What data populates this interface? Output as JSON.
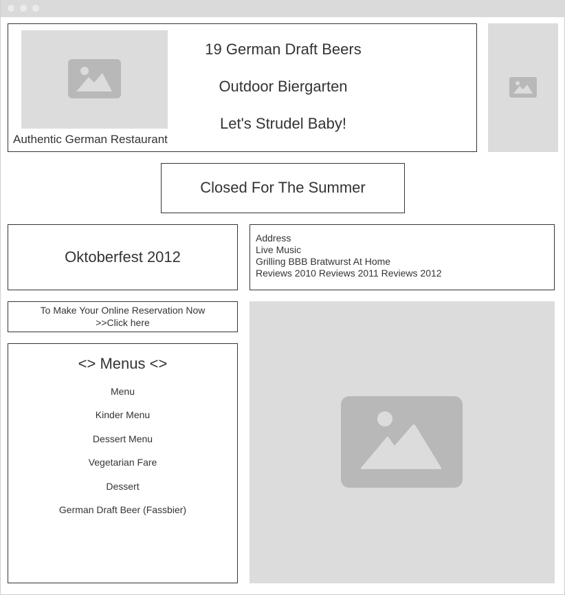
{
  "header": {
    "logo_caption": "Authentic German Restaurant",
    "highlights": [
      "19 German Draft Beers",
      "Outdoor Biergarten",
      "Let's Strudel Baby!"
    ]
  },
  "notice": "Closed For The Summer",
  "oktoberfest": "Oktoberfest 2012",
  "links": {
    "address": "Address",
    "live_music": "Live Music",
    "grilling": "Grilling BBB Bratwurst At Home",
    "reviews": [
      "Reviews 2010",
      "Reviews 2011",
      "Reviews 2012"
    ]
  },
  "reservation": {
    "line1": "To Make Your Online Reservation Now",
    "line2": ">>Click here"
  },
  "menus": {
    "title": "<> Menus <>",
    "items": [
      "Menu",
      "Kinder Menu",
      "Dessert Menu",
      "Vegetarian Fare",
      "Dessert",
      "German Draft Beer (Fassbier)"
    ]
  },
  "icons": {
    "image_placeholder": "image-icon"
  },
  "colors": {
    "placeholder_bg": "#dcdcdc",
    "placeholder_icon": "#b8b8b8",
    "border": "#333333",
    "titlebar": "#dadada"
  }
}
